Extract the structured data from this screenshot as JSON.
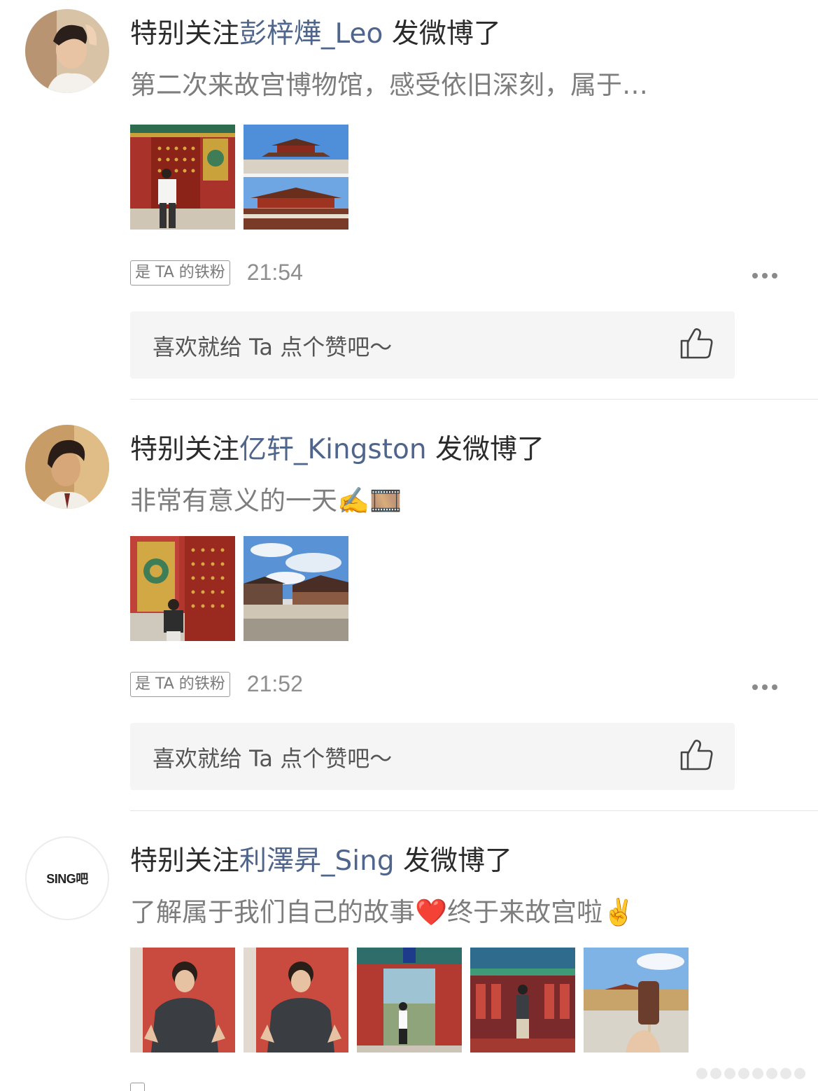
{
  "posts": [
    {
      "prefix": "特别关注",
      "user": "彭梓燁_Leo",
      "suffix": " 发微博了",
      "excerpt": "第二次来故宫博物馆，感受依旧深刻，属于…",
      "fan_badge": "是 TA 的铁粉",
      "time": "21:54",
      "like_prompt": "喜欢就给 Ta 点个赞吧～",
      "images": [
        "red-palace-door-photo",
        "palace-hall-collage-photo"
      ]
    },
    {
      "prefix": "特别关注",
      "user": "亿轩_Kingston",
      "suffix": " 发微博了",
      "excerpt": "非常有意义的一天✍️🎞️",
      "fan_badge": "是 TA 的铁粉",
      "time": "21:52",
      "like_prompt": "喜欢就给 Ta 点个赞吧～",
      "images": [
        "red-door-portrait-photo",
        "palace-sky-photo"
      ]
    },
    {
      "prefix": "特别关注",
      "user": "利澤昇_Sing",
      "suffix": " 发微博了",
      "excerpt": "了解属于我们自己的故事❤️终于来故宫啦✌️",
      "avatar_text": "SING吧",
      "images": [
        "red-wall-portrait-photo",
        "red-wall-portrait-photo-2",
        "red-gate-courtyard-photo",
        "painted-corridor-photo",
        "popsicle-palace-photo"
      ]
    }
  ],
  "colors": {
    "username": "#50658c",
    "like_bar_bg": "#f5f5f5",
    "excerpt": "#7d7d7d"
  }
}
